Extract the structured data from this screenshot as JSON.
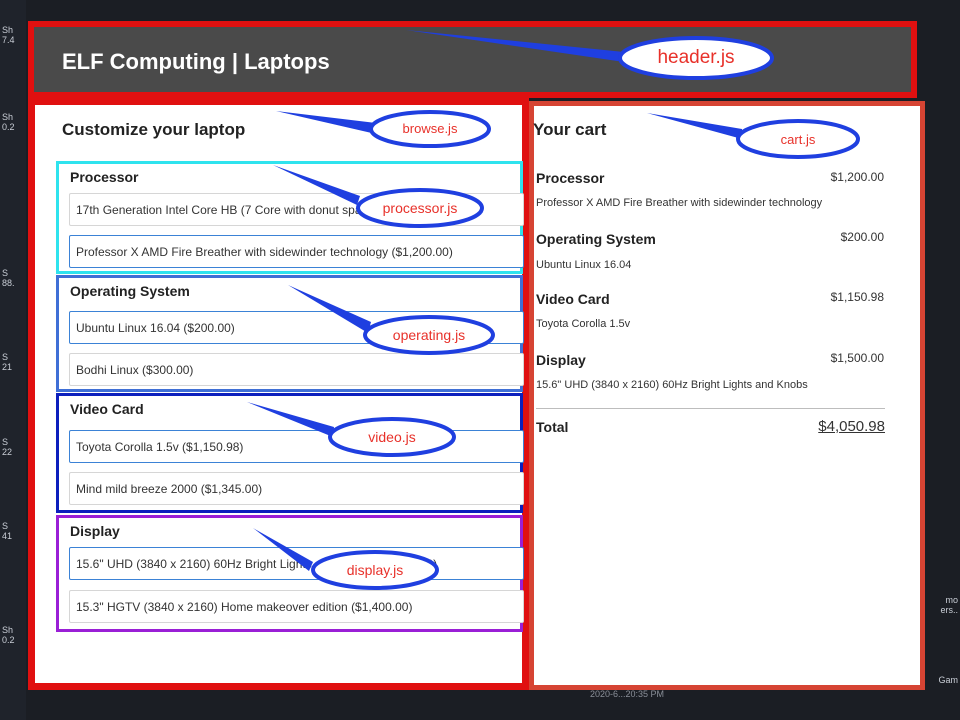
{
  "header": {
    "title": "ELF Computing | Laptops"
  },
  "browse": {
    "title": "Customize your laptop",
    "sections": [
      {
        "label": "Processor",
        "options": [
          "17th Generation Intel Core HB (7 Core with donut spare",
          "Professor X AMD Fire Breather with sidewinder technology ($1,200.00)"
        ]
      },
      {
        "label": "Operating System",
        "options": [
          "Ubuntu Linux 16.04 ($200.00)",
          "Bodhi Linux ($300.00)"
        ]
      },
      {
        "label": "Video Card",
        "options": [
          "Toyota Corolla 1.5v ($1,150.98)",
          "Mind mild breeze 2000 ($1,345.00)"
        ]
      },
      {
        "label": "Display",
        "options": [
          "15.6\" UHD (3840 x 2160) 60Hz Bright Lights and Knobs ($1,500.00)",
          "15.3\" HGTV (3840 x 2160) Home makeover edition ($1,400.00)"
        ]
      }
    ]
  },
  "cart": {
    "title": "Your cart",
    "rows": [
      {
        "label": "Processor",
        "price": "$1,200.00",
        "item": "Professor X AMD Fire Breather with sidewinder technology"
      },
      {
        "label": "Operating System",
        "price": "$200.00",
        "item": "Ubuntu Linux 16.04"
      },
      {
        "label": "Video Card",
        "price": "$1,150.98",
        "item": "Toyota Corolla 1.5v"
      },
      {
        "label": "Display",
        "price": "$1,500.00",
        "item": "15.6\" UHD (3840 x 2160) 60Hz Bright Lights and Knobs"
      }
    ],
    "total_label": "Total",
    "total_value": "$4,050.98"
  },
  "annotations": {
    "header": "header.js",
    "browse": "browse.js",
    "cart": "cart.js",
    "processor": "processor.js",
    "operating": "operating.js",
    "video": "video.js",
    "display": "display.js"
  },
  "background": {
    "left_fragments": [
      "Sh",
      "7.4",
      "Sh",
      "0.2",
      "S",
      "88.",
      "S",
      "21",
      "S",
      "22",
      "S",
      "41",
      "Sh",
      "0.2"
    ],
    "right_fragments": [
      "mo",
      "ers..",
      "Gam"
    ],
    "bottom_text": "2020-6...20:35 PM"
  },
  "colors": {
    "outline_red": "#e01010",
    "outline_cyan": "#2fe3ee",
    "outline_blue": "#3f6fd6",
    "outline_navy": "#0c1fbd",
    "outline_purple": "#9a1fd6",
    "callout_blue": "#1f3fe0",
    "callout_text": "#e8312a",
    "selected_border": "#3b82d6"
  }
}
